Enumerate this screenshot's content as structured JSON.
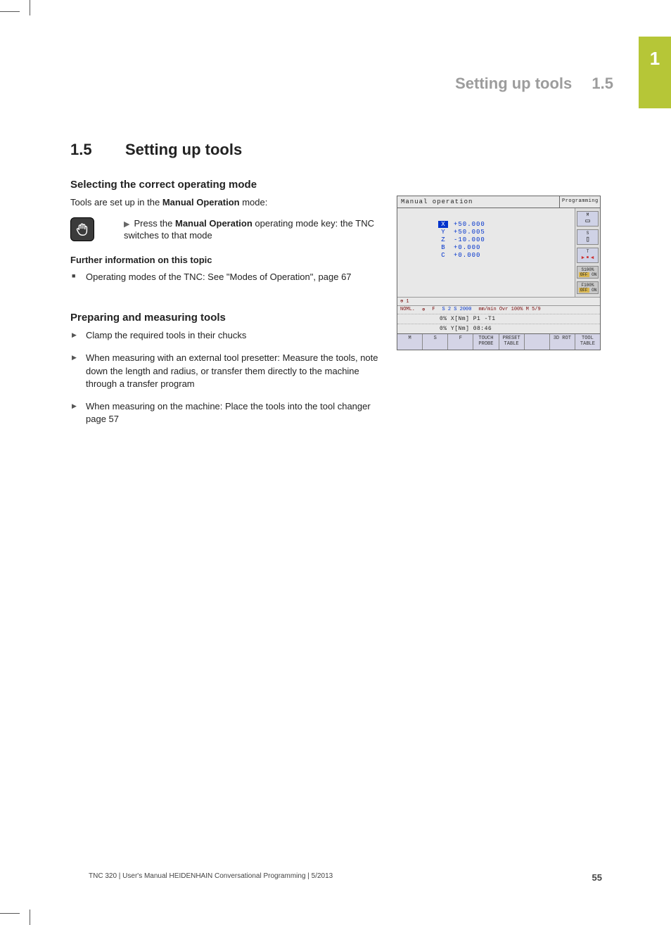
{
  "chapter_tab": "1",
  "running_header": {
    "title": "Setting up tools",
    "number": "1.5"
  },
  "section": {
    "number": "1.5",
    "title": "Setting up tools"
  },
  "sub1": {
    "title": "Selecting the correct operating mode",
    "lead_pre": "Tools are set up in the ",
    "lead_bold": "Manual Operation",
    "lead_post": " mode:",
    "key_pre": "Press the ",
    "key_bold": "Manual Operation",
    "key_post": " operating mode key: the TNC switches to that mode",
    "further_title": "Further information on this topic",
    "further_item": "Operating modes of the TNC: See \"Modes of Operation\", page 67"
  },
  "sub2": {
    "title": "Preparing and measuring tools",
    "items": [
      "Clamp the required tools in their chucks",
      "When measuring with an external tool presetter: Measure the tools, note down the length and radius, or transfer them directly to the machine through a transfer program",
      "When measuring on the machine: Place the tools into the tool changer page 57"
    ]
  },
  "screenshot": {
    "title_left": "Manual operation",
    "title_right": "Programming",
    "axes": [
      {
        "axis": "X",
        "value": "+50.000",
        "hl": true
      },
      {
        "axis": "Y",
        "value": "+50.005",
        "hl": false
      },
      {
        "axis": "Z",
        "value": "-10.000",
        "hl": false
      },
      {
        "axis": "B",
        "value": "+0.000",
        "hl": false
      },
      {
        "axis": "C",
        "value": "+0.000",
        "hl": false
      }
    ],
    "side": [
      "M",
      "S",
      "T",
      "S100%",
      "F100%"
    ],
    "status_top": {
      "l": "⊕ 1",
      "noml": "NOML.",
      "f": "F",
      "nums": "S 2 S 2000",
      "r": "mm/min Ovr 100% M 5/9"
    },
    "status_bar1": "0% X[Nm] P1 -T1",
    "status_bar2": "0% Y[Nm] 08:46",
    "softkeys": [
      "M",
      "S",
      "F",
      "TOUCH\nPROBE",
      "PRESET\nTABLE",
      "",
      "3D ROT",
      "TOOL\nTABLE"
    ]
  },
  "footer": {
    "text": "TNC 320 | User's Manual HEIDENHAIN Conversational Programming | 5/2013",
    "page": "55"
  }
}
